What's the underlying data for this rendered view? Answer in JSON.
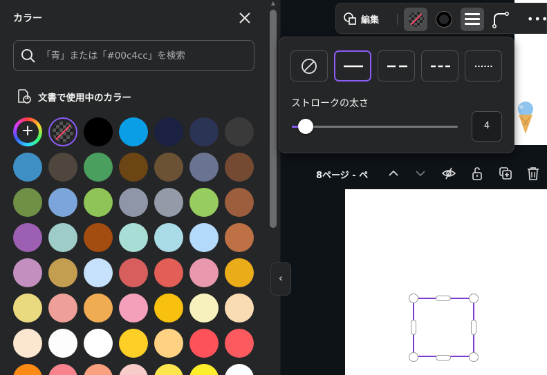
{
  "panel": {
    "title": "カラー",
    "search_placeholder": "「青」または「#00c4cc」を検索",
    "section_title": "文書で使用中のカラー",
    "swatches": [
      {
        "kind": "add"
      },
      {
        "kind": "transparent"
      },
      {
        "color": "#000000"
      },
      {
        "color": "#0a9ee6"
      },
      {
        "color": "#1a2142"
      },
      {
        "color": "#2c3456"
      },
      {
        "color": "#3a3a3b"
      },
      {
        "color": "#3d8fc4"
      },
      {
        "color": "#4f463d"
      },
      {
        "color": "#4a9e5e"
      },
      {
        "color": "#6b4514"
      },
      {
        "color": "#6b5235"
      },
      {
        "color": "#6a7492"
      },
      {
        "color": "#744a32"
      },
      {
        "color": "#6f9046"
      },
      {
        "color": "#7ca6db"
      },
      {
        "color": "#8fc457"
      },
      {
        "color": "#8e96a8"
      },
      {
        "color": "#959aa8"
      },
      {
        "color": "#97cd5e"
      },
      {
        "color": "#9c5e3c"
      },
      {
        "color": "#9c5fb2"
      },
      {
        "color": "#9dccc9"
      },
      {
        "color": "#a44d10"
      },
      {
        "color": "#a8ddd6"
      },
      {
        "color": "#aadce8"
      },
      {
        "color": "#b3dafa"
      },
      {
        "color": "#be7145"
      },
      {
        "color": "#c28fbf"
      },
      {
        "color": "#c49e50"
      },
      {
        "color": "#c5e1fb"
      },
      {
        "color": "#d65f5d"
      },
      {
        "color": "#e25e57"
      },
      {
        "color": "#e999ad"
      },
      {
        "color": "#ebac19"
      },
      {
        "color": "#e9d97f"
      },
      {
        "color": "#ee9f98"
      },
      {
        "color": "#f0ac52"
      },
      {
        "color": "#f5a0ba"
      },
      {
        "color": "#f8c00f"
      },
      {
        "color": "#f7f1bd"
      },
      {
        "color": "#f9dcb4"
      },
      {
        "color": "#fbe6d0"
      },
      {
        "color": "#fdfdfd"
      },
      {
        "color": "#ffffff"
      },
      {
        "color": "#fecf27"
      },
      {
        "color": "#fed282"
      },
      {
        "color": "#fd5259"
      },
      {
        "color": "#fd5a5f"
      },
      {
        "color": "#fc8a14"
      },
      {
        "color": "#f9838d"
      },
      {
        "color": "#f9a07f"
      },
      {
        "color": "#f9cbc8"
      },
      {
        "color": "#fde54d"
      },
      {
        "color": "#fdee2c"
      },
      {
        "color": "#ffffff"
      }
    ]
  },
  "toolbar": {
    "edit_label": "編集"
  },
  "stroke_popup": {
    "label": "ストロークの太さ",
    "value": "4",
    "level": 0.04
  },
  "page_bar": {
    "label": "8ページ - ペ"
  },
  "colors": {
    "accent": "#8b5cf6",
    "selection": "#7d3ccf",
    "panel_bg": "#252627"
  }
}
